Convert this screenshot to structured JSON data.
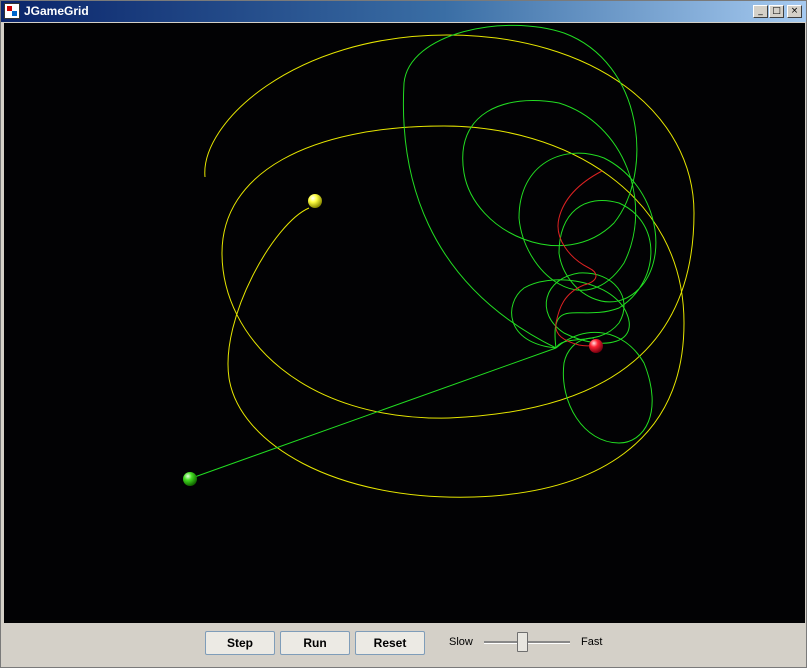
{
  "window": {
    "title": "JGameGrid",
    "caption_buttons": {
      "minimize": "_",
      "maximize": "□",
      "close": "×"
    },
    "icon": "jgamegrid-app-icon"
  },
  "controls": {
    "step_label": "Step",
    "run_label": "Run",
    "reset_label": "Reset",
    "slow_label": "Slow",
    "fast_label": "Fast",
    "speed_value": 0.45
  },
  "colors": {
    "canvas_background": "#020204",
    "yellow_body": "#ffff22",
    "green_body": "#33cc22",
    "red_body": "#ff2233",
    "yellow_trail": "#e6e600",
    "green_trail": "#22dd22",
    "red_trail": "#dd2222"
  }
}
